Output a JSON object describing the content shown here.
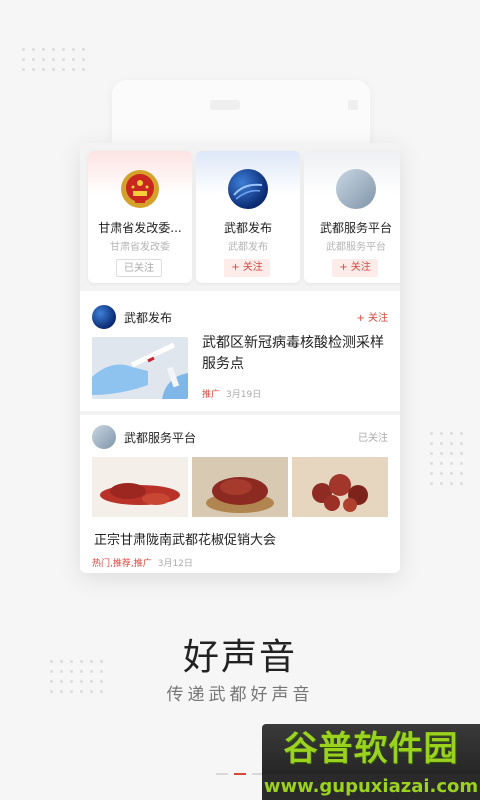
{
  "accounts": [
    {
      "name": "甘肃省发改委...",
      "subtitle": "甘肃省发改委",
      "button": "已关注",
      "state": "followed",
      "avatar": "national-emblem-icon"
    },
    {
      "name": "武都发布",
      "subtitle": "武都发布",
      "button": "+ 关注",
      "state": "follow",
      "avatar": "blue-wave-avatar"
    },
    {
      "name": "武都服务平台",
      "subtitle": "武都服务平台",
      "button": "+ 关注",
      "state": "follow",
      "avatar": "grey-photo-avatar"
    }
  ],
  "feed": [
    {
      "source": "武都发布",
      "action": "+ 关注",
      "title": "武都区新冠病毒核酸检测采样服务点",
      "tag": "推广",
      "date": "3月19日"
    },
    {
      "source": "武都服务平台",
      "action": "已关注",
      "title": "正宗甘肃陇南武都花椒促销大会",
      "tag": "热门,推荐,推广",
      "date": "3月12日"
    }
  ],
  "slogan": {
    "title": "好声音",
    "subtitle": "传递武都好声音"
  },
  "watermark": {
    "brand": "谷普软件园",
    "url": "www.gupuxiazai.com"
  },
  "colors": {
    "accent": "#d9473c",
    "background": "#f6f6f6"
  },
  "pager": {
    "pages": 3,
    "current": 2
  }
}
